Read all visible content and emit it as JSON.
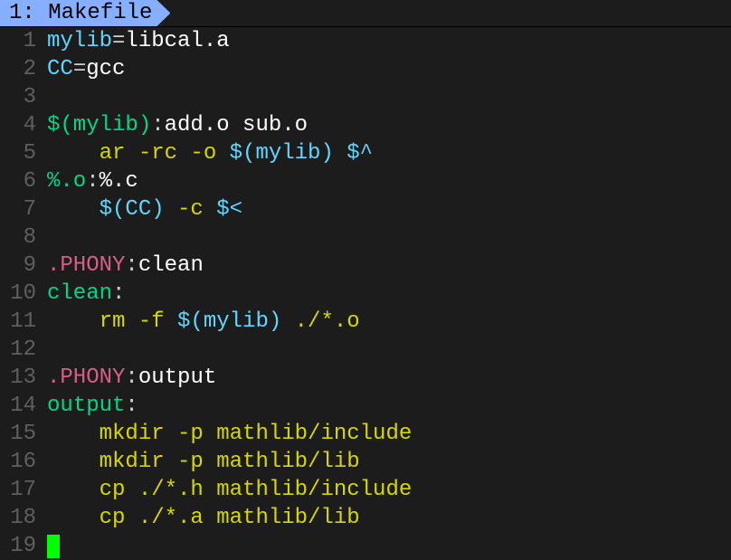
{
  "tab": {
    "label": "1: Makefile"
  },
  "lines": [
    {
      "num": "1",
      "tokens": [
        {
          "cls": "c-var",
          "text": "mylib"
        },
        {
          "cls": "c-punct",
          "text": "="
        },
        {
          "cls": "c-white",
          "text": "libcal.a"
        }
      ]
    },
    {
      "num": "2",
      "tokens": [
        {
          "cls": "c-var",
          "text": "CC"
        },
        {
          "cls": "c-punct",
          "text": "="
        },
        {
          "cls": "c-white",
          "text": "gcc"
        }
      ]
    },
    {
      "num": "3",
      "tokens": []
    },
    {
      "num": "4",
      "tokens": [
        {
          "cls": "c-target",
          "text": "$(mylib)"
        },
        {
          "cls": "c-punct",
          "text": ":"
        },
        {
          "cls": "c-white",
          "text": "add.o sub.o"
        }
      ]
    },
    {
      "num": "5",
      "tokens": [
        {
          "cls": "c-yellow",
          "text": "    ar -rc -o "
        },
        {
          "cls": "c-ref",
          "text": "$(mylib)"
        },
        {
          "cls": "c-yellow",
          "text": " "
        },
        {
          "cls": "c-ref",
          "text": "$^"
        }
      ]
    },
    {
      "num": "6",
      "tokens": [
        {
          "cls": "c-target",
          "text": "%.o"
        },
        {
          "cls": "c-punct",
          "text": ":"
        },
        {
          "cls": "c-white",
          "text": "%.c"
        }
      ]
    },
    {
      "num": "7",
      "tokens": [
        {
          "cls": "c-yellow",
          "text": "    "
        },
        {
          "cls": "c-ref",
          "text": "$(CC)"
        },
        {
          "cls": "c-yellow",
          "text": " -c "
        },
        {
          "cls": "c-ref",
          "text": "$<"
        }
      ]
    },
    {
      "num": "8",
      "tokens": []
    },
    {
      "num": "9",
      "tokens": [
        {
          "cls": "c-phony",
          "text": ".PHONY"
        },
        {
          "cls": "c-punct",
          "text": ":"
        },
        {
          "cls": "c-white",
          "text": "clean"
        }
      ]
    },
    {
      "num": "10",
      "tokens": [
        {
          "cls": "c-target",
          "text": "clean"
        },
        {
          "cls": "c-punct",
          "text": ":"
        }
      ]
    },
    {
      "num": "11",
      "tokens": [
        {
          "cls": "c-yellow",
          "text": "    rm -f "
        },
        {
          "cls": "c-ref",
          "text": "$(mylib)"
        },
        {
          "cls": "c-yellow",
          "text": " ./*.o"
        }
      ]
    },
    {
      "num": "12",
      "tokens": []
    },
    {
      "num": "13",
      "tokens": [
        {
          "cls": "c-phony",
          "text": ".PHONY"
        },
        {
          "cls": "c-punct",
          "text": ":"
        },
        {
          "cls": "c-white",
          "text": "output"
        }
      ]
    },
    {
      "num": "14",
      "tokens": [
        {
          "cls": "c-target",
          "text": "output"
        },
        {
          "cls": "c-punct",
          "text": ":"
        }
      ]
    },
    {
      "num": "15",
      "tokens": [
        {
          "cls": "c-yellow",
          "text": "    mkdir -p mathlib/include"
        }
      ]
    },
    {
      "num": "16",
      "tokens": [
        {
          "cls": "c-yellow",
          "text": "    mkdir -p mathlib/lib"
        }
      ]
    },
    {
      "num": "17",
      "tokens": [
        {
          "cls": "c-yellow",
          "text": "    cp ./*.h mathlib/include"
        }
      ]
    },
    {
      "num": "18",
      "tokens": [
        {
          "cls": "c-yellow",
          "text": "    cp ./*.a mathlib/lib"
        }
      ]
    },
    {
      "num": "19",
      "tokens": [],
      "cursor": true
    }
  ]
}
